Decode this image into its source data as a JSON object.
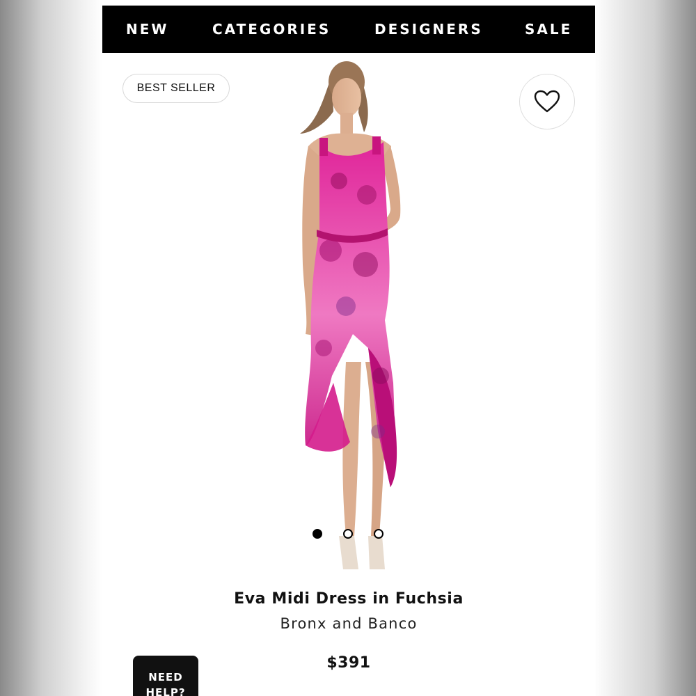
{
  "nav": {
    "items": [
      "NEW",
      "CATEGORIES",
      "DESIGNERS",
      "SALE"
    ]
  },
  "product": {
    "badge": "BEST SELLER",
    "title": "Eva Midi Dress in Fuchsia",
    "brand": "Bronx and Banco",
    "price": "$391",
    "image_count": 3,
    "active_image": 1
  },
  "help_button": {
    "line1": "NEED",
    "line2": "HELP?"
  },
  "icons": {
    "wishlist": "heart-icon"
  },
  "colors": {
    "nav_bg": "#000000",
    "nav_text": "#ffffff",
    "dress": "#d81b8c",
    "help_bg": "#111111"
  }
}
